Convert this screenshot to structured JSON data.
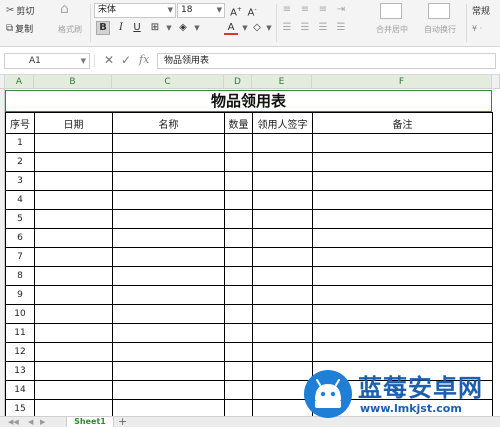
{
  "ribbon": {
    "cut_label": "剪切",
    "copy_label": "复制",
    "format_painter_label": "格式刷",
    "font_name": "宋体",
    "font_size": "18",
    "bold_label": "B",
    "italic_label": "I",
    "underline_label": "U",
    "font_color_label": "A",
    "merge_label": "合并居中",
    "wrap_label": "自动换行",
    "number_format": "常规"
  },
  "formula_bar": {
    "cell_ref": "A1",
    "fx_label": "fx",
    "content": "物品领用表"
  },
  "columns": [
    "A",
    "B",
    "C",
    "D",
    "E",
    "F"
  ],
  "sheet": {
    "title": "物品领用表",
    "headers": [
      "序号",
      "日期",
      "名称",
      "数量",
      "领用人签字",
      "备注"
    ],
    "row_numbers": [
      "1",
      "2",
      "3",
      "4",
      "5",
      "6",
      "7",
      "8",
      "9",
      "10",
      "11",
      "12",
      "13",
      "14",
      "15"
    ]
  },
  "tabs": {
    "active_sheet": "Sheet1",
    "add_label": "+"
  },
  "watermark": {
    "title": "蓝莓安卓网",
    "url": "www.lmkjst.com"
  },
  "colors": {
    "accent_green": "#2e8b2e",
    "watermark_blue": "#1f7fd6"
  }
}
